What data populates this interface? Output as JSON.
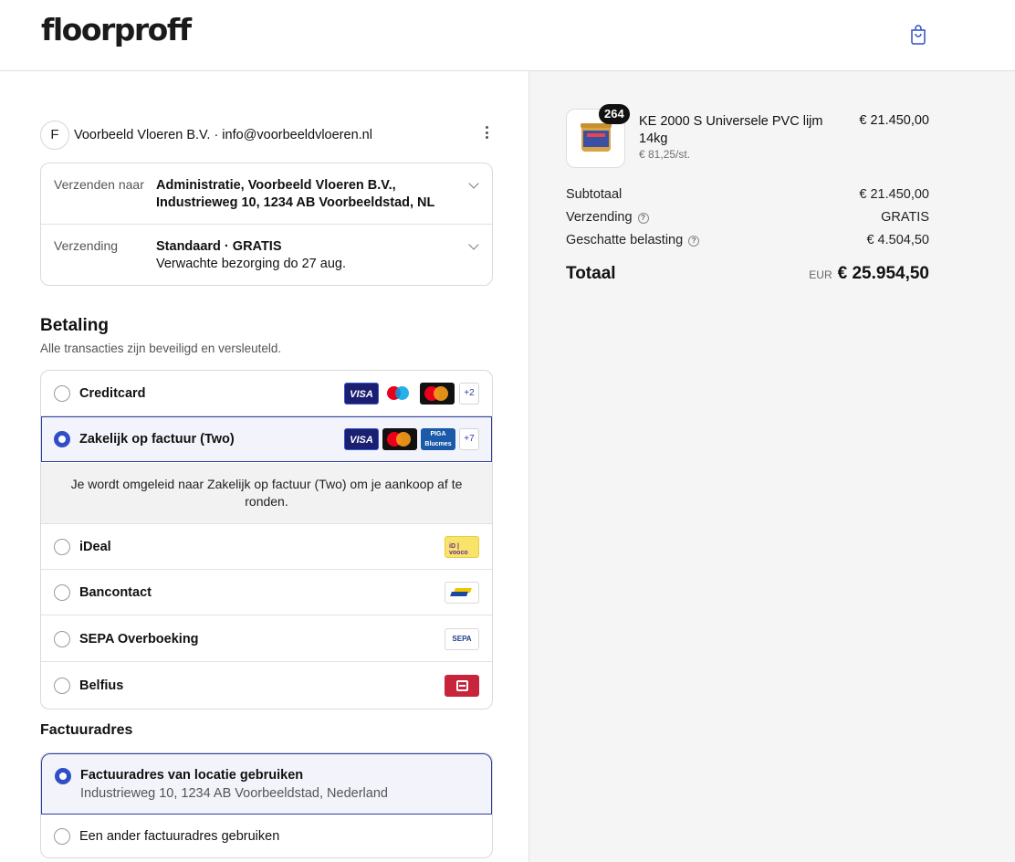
{
  "brand": {
    "logo_text": "floorproff"
  },
  "cart_icon": "shopping-bag-icon",
  "contact": {
    "avatar_letter": "F",
    "text": "Voorbeeld Vloeren B.V. · info@voorbeeldvloeren.nl"
  },
  "shipping": {
    "ship_to_label": "Verzenden naar",
    "ship_to_line1": "Administratie, Voorbeeld Vloeren B.V.,",
    "ship_to_line2": "Industrieweg 10, 1234 AB Voorbeeldstad, NL",
    "method_label": "Verzending",
    "method_line1": "Standaard · GRATIS",
    "method_line2": "Verwachte bezorging do 27 aug."
  },
  "payment": {
    "title": "Betaling",
    "subtitle": "Alle transacties zijn beveiligd en versleuteld.",
    "options": [
      {
        "label": "Creditcard",
        "selected": false,
        "more": "+2"
      },
      {
        "label": "Zakelijk op factuur (Two)",
        "selected": true,
        "more": "+7"
      },
      {
        "label": "iDeal",
        "selected": false
      },
      {
        "label": "Bancontact",
        "selected": false
      },
      {
        "label": "SEPA Overboeking",
        "selected": false
      },
      {
        "label": "Belfius",
        "selected": false
      }
    ],
    "visa_text": "VISA",
    "bijen_text": "PIGA Blucmes",
    "ideal_logo_text": "iD | vooco",
    "sepa_logo_text": "SEPA",
    "redirect_text": "Je wordt omgeleid naar Zakelijk op factuur (Two) om je aankoop af te ronden."
  },
  "billing": {
    "title": "Factuuradres",
    "option1_title": "Factuuradres van locatie gebruiken",
    "option1_sub": "Industrieweg 10, 1234 AB Voorbeeldstad, Nederland",
    "option2_title": "Een ander factuuradres gebruiken"
  },
  "order": {
    "quantity": "264",
    "item_name": "KE 2000 S Universele PVC lijm 14kg",
    "item_unit_price": "€ 81,25/st.",
    "item_price": "€ 21.450,00",
    "subtotal_label": "Subtotaal",
    "subtotal_value": "€ 21.450,00",
    "shipping_label": "Verzending",
    "shipping_value": "GRATIS",
    "tax_label": "Geschatte belasting",
    "tax_value": "€ 4.504,50",
    "total_label": "Totaal",
    "total_currency": "EUR",
    "total_value": "€ 25.954,50"
  },
  "colors": {
    "accent": "#2f4fc7",
    "selected_bg": "#f3f4fb",
    "panel_bg": "#f5f5f5"
  }
}
